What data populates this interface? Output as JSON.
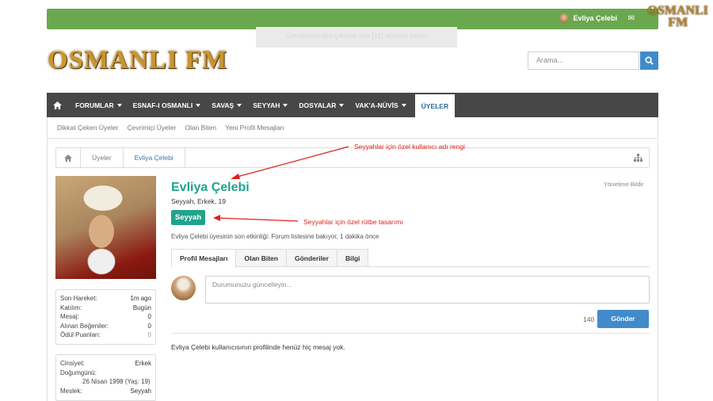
{
  "topbar": {
    "username": "Evliya Çelebi",
    "toast": "Gerekenlerden çıkmak için [11] düşüşe basın"
  },
  "corner_logo": {
    "line1": "OSMANLI",
    "line2": "FM"
  },
  "site_logo": "OSMANLI FM",
  "search": {
    "placeholder": "Arama..."
  },
  "nav": {
    "items": [
      "FORUMLAR",
      "ESNAF-I OSMANLI",
      "SAVAŞ",
      "SEYYAH",
      "DOSYALAR",
      "VAK'A-NÜVİS"
    ],
    "active": "ÜYELER"
  },
  "subnav": [
    "Dikkat Çeken Üyeler",
    "Çevrimiçi Üyeler",
    "Olan Biten",
    "Yeni Profil Mesajları"
  ],
  "breadcrumb": [
    "Üyeler",
    "Evliya Çelebi"
  ],
  "profile": {
    "name": "Evliya Çelebi",
    "title": "Seyyah, Erkek, 19",
    "rank": "Seyyah",
    "report": "Yönetime Bildir",
    "activity_prefix": "Evliya Çelebi üyesinin son etkinliği:",
    "activity_link": "Forum listesine bakıyor,",
    "activity_time": "1 dakika önce"
  },
  "stats": [
    {
      "label": "Son Hareket:",
      "value": "1m ago"
    },
    {
      "label": "Katılım:",
      "value": "Bugün"
    },
    {
      "label": "Mesaj:",
      "value": "0"
    },
    {
      "label": "Alınan Beğeniler:",
      "value": "0"
    },
    {
      "label": "Ödül Puanları:",
      "value": "0"
    }
  ],
  "info": {
    "gender_label": "Cinsiyet:",
    "gender": "Erkek",
    "birthday_label": "Doğumgünü:",
    "birthday": "26 Nisan 1998 (Yaş: 19)",
    "job_label": "Meslek:",
    "job": "Seyyah"
  },
  "tabs": [
    "Profil Mesajları",
    "Olan Biten",
    "Gönderiler",
    "Bilgi"
  ],
  "status": {
    "placeholder": "Durumunuzu güncelleyin...",
    "counter": "140",
    "send": "Gönder"
  },
  "no_messages": "Evliya Çelebi kullanıcısının profilinde henüz hiç mesaj yok.",
  "annotations": {
    "name_color": "Seyyahlar için özel kullanıcı adı rengi",
    "rank_design": "Seyyahlar için özel rütbe tasarımı"
  },
  "colors": {
    "accent": "#20a38b",
    "topbar": "#6aa84f",
    "nav": "#474747",
    "button": "#428bca",
    "annotation": "#e0201a"
  }
}
